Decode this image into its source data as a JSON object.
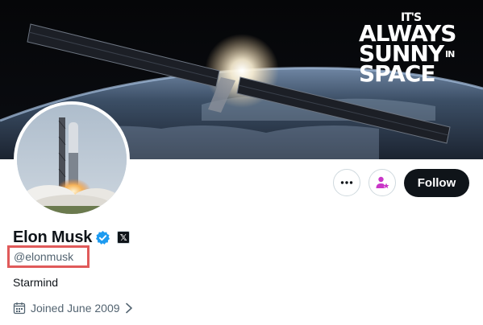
{
  "banner": {
    "slogan_top": "IT'S",
    "slogan_line1": "ALWAYS",
    "slogan_line2": "SUNNY",
    "slogan_in": "IN",
    "slogan_line3": "SPACE"
  },
  "actions": {
    "more_icon": "more-horizontal-icon",
    "subscribe_icon": "person-star-icon",
    "follow_label": "Follow"
  },
  "profile": {
    "display_name": "Elon Musk",
    "verified_icon": "verified-badge-icon",
    "affiliation_icon": "x-logo-icon",
    "affiliation_glyph": "𝕏",
    "handle": "@elonmusk",
    "bio": "Starmind",
    "joined": "Joined June 2009"
  },
  "colors": {
    "verified_blue": "#1d9bf0",
    "subscribe_pink": "#c936c7",
    "highlight_red": "#e05a5a",
    "follow_bg": "#0f1419"
  }
}
